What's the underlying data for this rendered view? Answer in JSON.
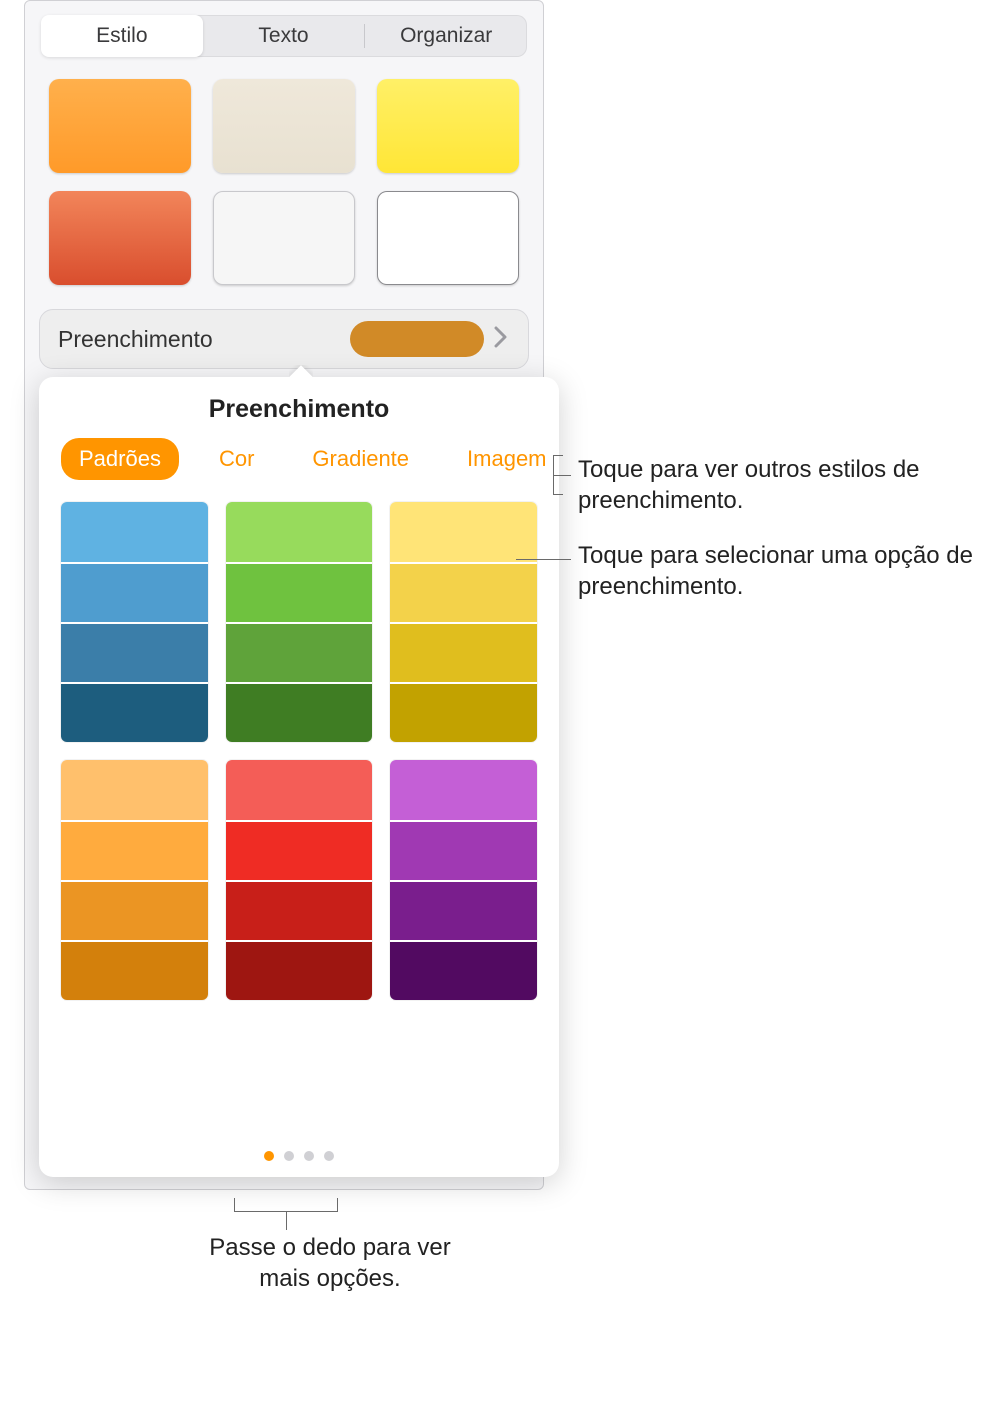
{
  "tabs": {
    "style": "Estilo",
    "text": "Texto",
    "arrange": "Organizar"
  },
  "style_swatches": [
    {
      "bg": "linear-gradient(#ffb04c,#ff9a29)"
    },
    {
      "bg": "linear-gradient(#efe8da,#e8e1d1)"
    },
    {
      "bg": "linear-gradient(#fff067,#ffe636)"
    },
    {
      "bg": "linear-gradient(#f2855a,#d94e2e)"
    },
    {
      "bg": "#f6f6f6",
      "border": "1px solid #c8c8cc"
    },
    {
      "bg": "#ffffff",
      "border": "1.5px solid #8a8a8e"
    }
  ],
  "fill_row": {
    "label": "Preenchimento",
    "current_color": "#d18a27"
  },
  "popover": {
    "title": "Preenchimento",
    "tabs": {
      "presets": "Padrões",
      "color": "Cor",
      "gradient": "Gradiente",
      "image": "Imagem"
    },
    "page_count": 4,
    "active_page": 0,
    "presets": [
      [
        "#5fb2e2",
        "#4f9dcf",
        "#3b7ea9",
        "#1d5d7e"
      ],
      [
        "#97db5c",
        "#6fc23f",
        "#5fa33a",
        "#3f7d23"
      ],
      [
        "#ffe477",
        "#f3d24a",
        "#e0be1e",
        "#c2a200"
      ],
      [
        "#ffc06c",
        "#ffab3e",
        "#eb9523",
        "#d3800c"
      ],
      [
        "#f45d57",
        "#ef2c24",
        "#c81f19",
        "#9e1611"
      ],
      [
        "#c45fd6",
        "#a039b3",
        "#7a1e8d",
        "#520a61"
      ]
    ]
  },
  "callouts": {
    "tabs_tip": "Toque para ver outros estilos de preenchimento.",
    "swatch_tip": "Toque para selecionar uma opção de preenchimento.",
    "swipe_tip": "Passe o dedo para ver mais opções."
  }
}
